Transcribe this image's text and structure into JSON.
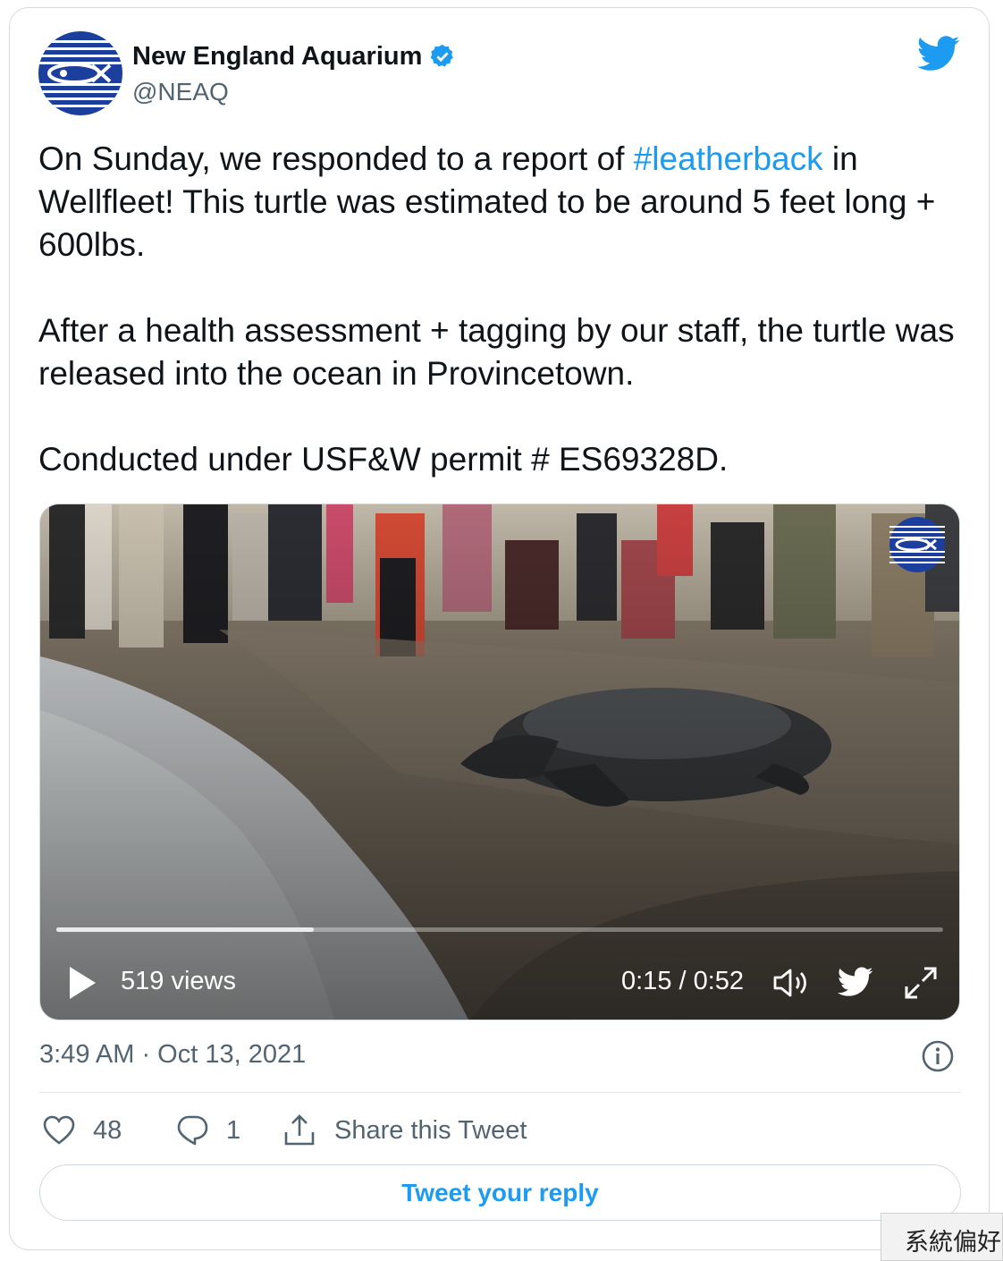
{
  "account": {
    "name": "New England Aquarium",
    "handle": "@NEAQ",
    "verified": true,
    "brand_color": "#1d9bf0",
    "logo_color": "#1c3f9e"
  },
  "tweet": {
    "p1_before": "On Sunday, we responded to a report of ",
    "p1_hashtag": "#leatherback",
    "p1_after": " in Wellfleet! This turtle was estimated to be around 5 feet long + 600lbs.",
    "p2": "After a health assessment + tagging by our staff, the turtle was released into the ocean in Provincetown.",
    "p3": "Conducted under USF&W permit # ES69328D."
  },
  "video": {
    "views": "519 views",
    "time": "0:15 / 0:52",
    "progress": 0.29
  },
  "meta": {
    "timestamp": "3:49 AM · Oct 13, 2021"
  },
  "actions": {
    "likes": "48",
    "replies": "1",
    "share": "Share this Tweet",
    "reply_button": "Tweet your reply"
  },
  "system_tooltip": "系統偏好"
}
